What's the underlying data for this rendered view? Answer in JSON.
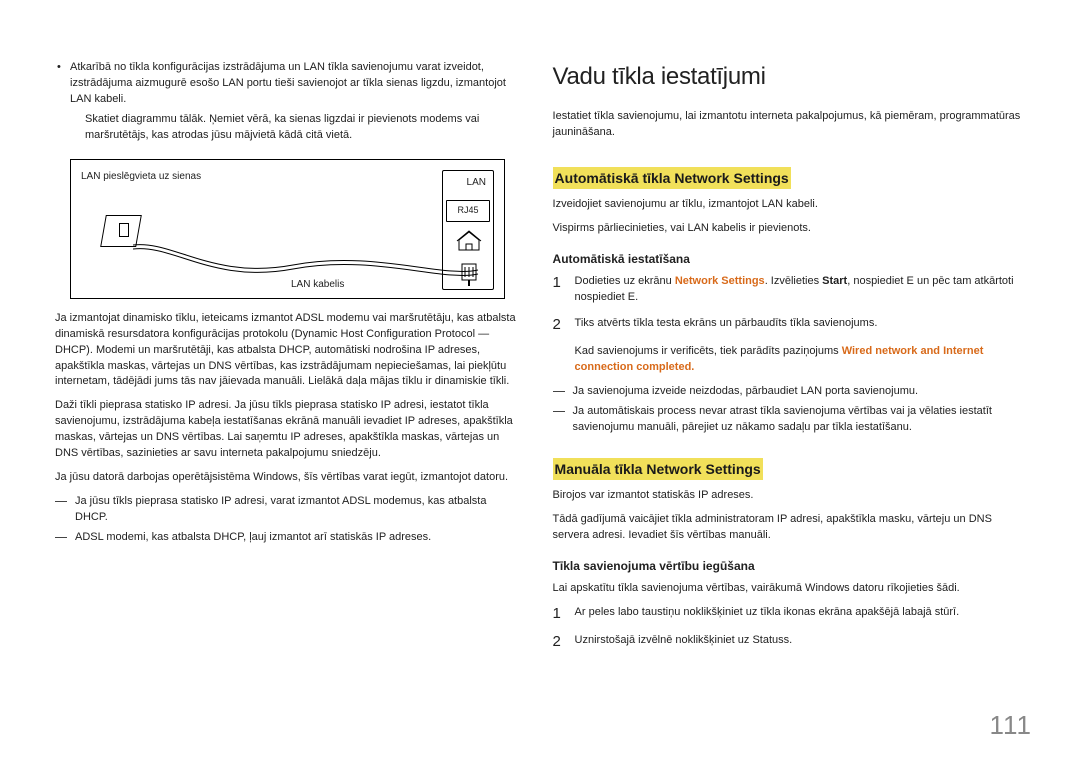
{
  "left": {
    "bullet1_a": "Atkarībā no tīkla konfigurācijas izstrādājuma un LAN tīkla savienojumu varat izveidot, izstrādājuma aizmugurē esošo LAN portu tieši savienojot ar tīkla sienas ligzdu, izmantojot LAN kabeli.",
    "bullet1_b": "Skatiet diagrammu tālāk. Ņemiet vērā, ka sienas ligzdai ir pievienots modems vai maršrutētājs, kas atrodas jūsu mājvietā kādā citā vietā.",
    "diagram": {
      "wall_label": "LAN pieslēgvieta uz sienas",
      "cable_label": "LAN kabelis",
      "lan_label": "LAN",
      "rj_label": "RJ45"
    },
    "p1": "Ja izmantojat dinamisko tīklu, ieteicams izmantot ADSL modemu vai maršrutētāju, kas atbalsta dinamiskā resursdatora konfigurācijas protokolu (Dynamic Host Configuration Protocol — DHCP). Modemi un maršrutētāji, kas atbalsta DHCP, automātiski nodrošina IP adreses, apakštīkla maskas, vārtejas un DNS vērtības, kas izstrādājumam nepieciešamas, lai piekļūtu internetam, tādējādi jums tās nav jāievada manuāli. Lielākā daļa mājas tīklu ir dinamiskie tīkli.",
    "p2": "Daži tīkli pieprasa statisko IP adresi. Ja jūsu tīkls pieprasa statisko IP adresi, iestatot tīkla savienojumu, izstrādājuma kabeļa iestatīšanas ekrānā manuāli ievadiet IP adreses, apakštīkla maskas, vārtejas un DNS vērtības. Lai saņemtu IP adreses, apakštīkla maskas, vārtejas un DNS vērtības, sazinieties ar savu interneta pakalpojumu sniedzēju.",
    "p3": "Ja jūsu datorā darbojas operētājsistēma Windows, šīs vērtības varat iegūt, izmantojot datoru.",
    "d1": "Ja jūsu tīkls pieprasa statisko IP adresi, varat izmantot ADSL modemus, kas atbalsta DHCP.",
    "d2": "ADSL modemi, kas atbalsta DHCP, ļauj izmantot arī statiskās IP adreses."
  },
  "right": {
    "title": "Vadu tīkla iestatījumi",
    "intro": "Iestatiet tīkla savienojumu, lai izmantotu interneta pakalpojumus, kā piemēram, programmatūras jaunināšana.",
    "h_auto": "Automātiskā tīkla Network Settings",
    "auto_p1": "Izveidojiet savienojumu ar tīklu, izmantojot LAN kabeli.",
    "auto_p2": "Vispirms pārliecinieties, vai LAN kabelis ir pievienots.",
    "sub_auto": "Automātiskā iestatīšana",
    "step1_a": "Dodieties uz ekrānu ",
    "step1_ns": "Network Settings",
    "step1_b": ". Izvēlieties ",
    "step1_start": "Start",
    "step1_c": ", nospiediet ",
    "step1_enter": "E",
    "step1_d": " un pēc tam atkārtoti nospiediet ",
    "step1_e": ".",
    "step2": "Tiks atvērts tīkla testa ekrāns un pārbaudīts tīkla savienojums.",
    "step2_sub_a": "Kad savienojums ir verificēts, tiek parādīts paziņojums ",
    "step2_sub_orange": "Wired network and Internet connection completed.",
    "dash_a": "Ja savienojuma izveide neizdodas, pārbaudiet LAN porta savienojumu.",
    "dash_b": "Ja automātiskais process nevar atrast tīkla savienojuma vērtības vai ja vēlaties iestatīt savienojumu manuāli, pārejiet uz nākamo sadaļu par tīkla iestatīšanu.",
    "h_manual": "Manuāla tīkla Network Settings",
    "man_p1": "Birojos var izmantot statiskās IP adreses.",
    "man_p2": "Tādā gadījumā vaicājiet tīkla administratoram IP adresi, apakštīkla masku, vārteju un DNS servera adresi. Ievadiet šīs vērtības manuāli.",
    "sub_man": "Tīkla savienojuma vērtību iegūšana",
    "man_intro": "Lai apskatītu tīkla savienojuma vērtības, vairākumā Windows datoru rīkojieties šādi.",
    "mstep1": "Ar peles labo taustiņu noklikšķiniet uz tīkla ikonas ekrāna apakšējā labajā stūrī.",
    "mstep2": "Uznirstošajā izvēlnē noklikšķiniet uz Statuss."
  },
  "page_number": "111"
}
